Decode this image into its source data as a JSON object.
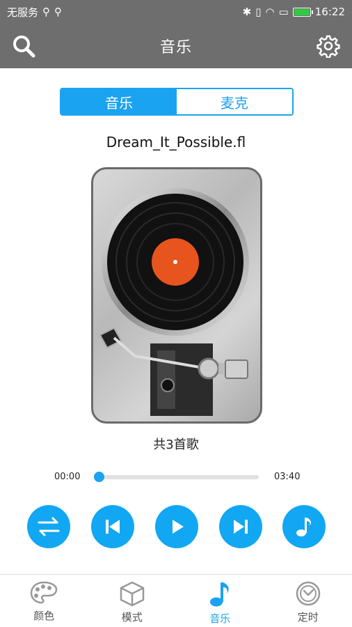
{
  "status": {
    "carrier": "无服务",
    "time": "16:22"
  },
  "header": {
    "title": "音乐"
  },
  "segment": {
    "music": "音乐",
    "mic": "麦克"
  },
  "player": {
    "song": "Dream_It_Possible.fl",
    "count": "共3首歌",
    "elapsed": "00:00",
    "total": "03:40",
    "progress": 0
  },
  "tabs": [
    {
      "label": "颜色",
      "icon": "palette-icon"
    },
    {
      "label": "模式",
      "icon": "cube-icon"
    },
    {
      "label": "音乐",
      "icon": "music-note-icon"
    },
    {
      "label": "定时",
      "icon": "clock-icon"
    }
  ],
  "colors": {
    "accent": "#1aa3f0",
    "bar": "#6e6e6e"
  }
}
